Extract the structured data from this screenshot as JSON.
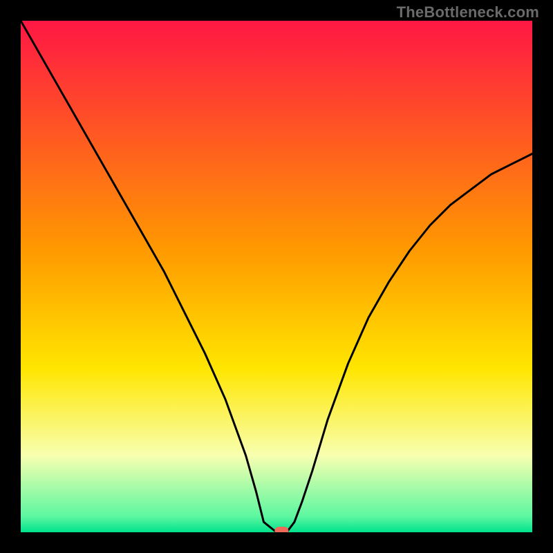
{
  "watermark": "TheBottleneck.com",
  "chart_data": {
    "type": "line",
    "title": "",
    "xlabel": "",
    "ylabel": "",
    "xlim": [
      0,
      100
    ],
    "ylim": [
      0,
      100
    ],
    "grid": false,
    "legend": false,
    "background_gradient": {
      "stops": [
        {
          "offset": 0.0,
          "color": "#ff1744"
        },
        {
          "offset": 0.45,
          "color": "#ff9a00"
        },
        {
          "offset": 0.68,
          "color": "#ffe600"
        },
        {
          "offset": 0.85,
          "color": "#f8ffb0"
        },
        {
          "offset": 0.97,
          "color": "#5bf7a0"
        },
        {
          "offset": 1.0,
          "color": "#00e28c"
        }
      ]
    },
    "series": [
      {
        "name": "curve",
        "color": "#000000",
        "x": [
          0,
          4,
          8,
          12,
          16,
          20,
          24,
          28,
          32,
          36,
          40,
          44,
          46,
          47.5,
          50,
          52,
          53.5,
          55,
          57,
          60,
          64,
          68,
          72,
          76,
          80,
          84,
          88,
          92,
          96,
          100
        ],
        "y": [
          100,
          93,
          86,
          79,
          72,
          65,
          58,
          51,
          43,
          35,
          26,
          15,
          8,
          2,
          0,
          0,
          2,
          6,
          12,
          22,
          33,
          42,
          49,
          55,
          60,
          64,
          67,
          70,
          72,
          74
        ]
      }
    ],
    "marker": {
      "name": "optimum-marker",
      "shape": "rounded-pill",
      "x": 51,
      "y": 0,
      "color": "#ef6a5a"
    }
  }
}
